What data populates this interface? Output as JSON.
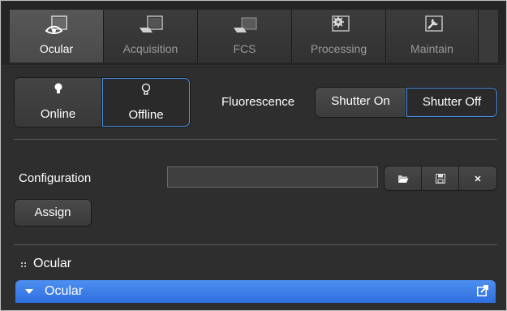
{
  "tabs": [
    {
      "label": "Ocular",
      "icon": "ocular-icon",
      "active": true
    },
    {
      "label": "Acquisition",
      "icon": "acquisition-icon",
      "active": false
    },
    {
      "label": "FCS",
      "icon": "fcs-icon",
      "active": false
    },
    {
      "label": "Processing",
      "icon": "processing-icon",
      "active": false
    },
    {
      "label": "Maintain",
      "icon": "maintain-icon",
      "active": false
    }
  ],
  "mode": {
    "online_label": "Online",
    "offline_label": "Offline",
    "selected": "Offline"
  },
  "fluorescence": {
    "label": "Fluorescence",
    "shutter_on_label": "Shutter On",
    "shutter_off_label": "Shutter Off",
    "selected": "Shutter Off"
  },
  "configuration": {
    "label": "Configuration",
    "value": "",
    "buttons": [
      "open-folder-icon",
      "save-icon",
      "close-icon"
    ]
  },
  "assign_label": "Assign",
  "section": {
    "title": "Ocular",
    "expander_label": "Ocular"
  },
  "colors": {
    "accent": "#3a7ee8",
    "background": "#2e2e2e"
  }
}
